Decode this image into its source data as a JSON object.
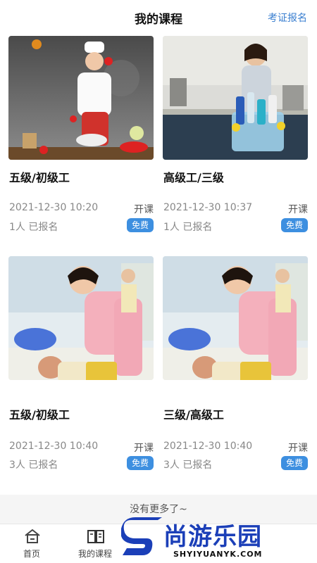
{
  "header": {
    "title": "我的课程",
    "action": "考证报名"
  },
  "courses": [
    {
      "name": "五级/初级工",
      "time": "2021-12-30 10:20",
      "status": "开课",
      "count": "1人 已报名",
      "badge": "免费"
    },
    {
      "name": "高级工/三级",
      "time": "2021-12-30 10:37",
      "status": "开课",
      "count": "1人 已报名",
      "badge": "免费"
    },
    {
      "name": "五级/初级工",
      "time": "2021-12-30 10:40",
      "status": "开课",
      "count": "3人 已报名",
      "badge": "免费"
    },
    {
      "name": "三级/高级工",
      "time": "2021-12-30 10:40",
      "status": "开课",
      "count": "3人 已报名",
      "badge": "免费"
    }
  ],
  "end_text": "没有更多了~",
  "tabbar": {
    "items": [
      {
        "label": "首页",
        "icon": "home-icon"
      },
      {
        "label": "我的课程",
        "icon": "book-icon"
      }
    ]
  },
  "watermark": {
    "text": "尚游乐园",
    "url": "SHYIYUANYK.COM"
  },
  "colors": {
    "accent": "#3d8fe0",
    "link": "#3a7fd0",
    "watermark": "#1b3fb8"
  }
}
